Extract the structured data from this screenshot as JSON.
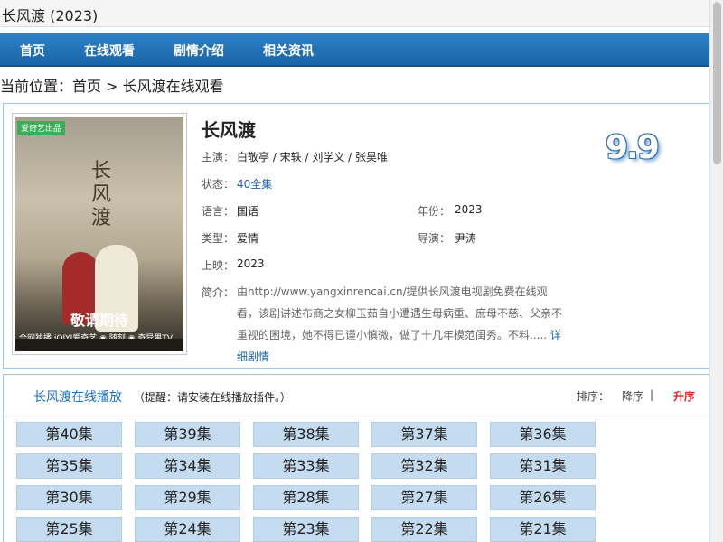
{
  "window": {
    "title": "长风渡 (2023)"
  },
  "nav": {
    "items": [
      "首页",
      "在线观看",
      "剧情介绍",
      "相关资讯"
    ]
  },
  "breadcrumb": {
    "prefix": "当前位置：",
    "home": "首页",
    "separator": " > ",
    "current": "长风渡在线观看"
  },
  "poster": {
    "tag": "爱奇艺出品",
    "calligraphy": "长风渡",
    "slogan": "敬请期待",
    "brands": "全网独播  iQIYI爱奇艺  ◉ 随刻  ◉ 奇异果TV"
  },
  "info": {
    "title": "长风渡",
    "score": "9.9",
    "labels": {
      "cast": "主演：",
      "status": "状态：",
      "language": "语言：",
      "year": "年份：",
      "genre": "类型：",
      "director": "导演：",
      "release": "上映：",
      "synopsis": "简介："
    },
    "cast": "白敬亭 / 宋轶 / 刘学义 / 张昊唯",
    "status": "40全集",
    "language": "国语",
    "year": "2023",
    "genre": "爱情",
    "director": "尹涛",
    "release": "2023",
    "synopsis": "由http://www.yangxinrencai.cn/提供长风渡电视剧免费在线观看，该剧讲述布商之女柳玉茹自小遭遇生母病重、庶母不慈、父亲不重视的困境，她不得已谨小慎微，做了十几年模范闺秀。不料.....",
    "more_link": "详细剧情"
  },
  "playlist": {
    "title": "长风渡在线播放",
    "tip": "（提醒：请安装在线播放插件。）",
    "sort_label": "排序：",
    "sort_desc": "降序",
    "sort_sep": "|",
    "sort_asc": "升序",
    "episodes": [
      "第40集",
      "第39集",
      "第38集",
      "第37集",
      "第36集",
      "第35集",
      "第34集",
      "第33集",
      "第32集",
      "第31集",
      "第30集",
      "第29集",
      "第28集",
      "第27集",
      "第26集",
      "第25集",
      "第24集",
      "第23集",
      "第22集",
      "第21集"
    ]
  },
  "colors": {
    "nav_bg": "#1e6cb0",
    "accent_link": "#1c5fa8",
    "sort_active": "#d42a2a",
    "episode_bg": "#c5dcf0",
    "border": "#9fc4e6"
  }
}
